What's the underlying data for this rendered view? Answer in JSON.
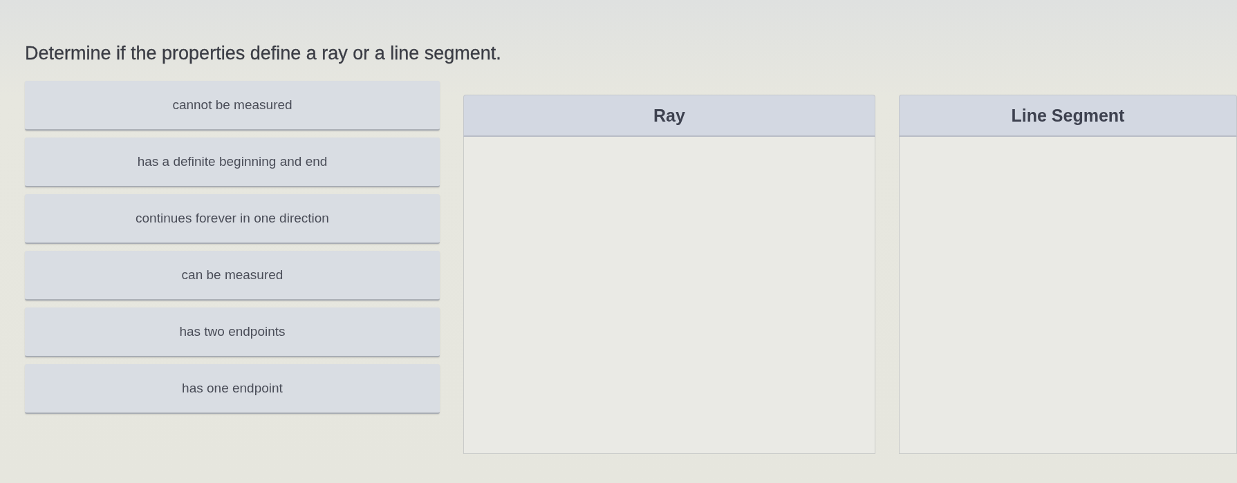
{
  "prompt": "Determine if the properties define a ray or a line segment.",
  "tiles": [
    {
      "label": "cannot be measured"
    },
    {
      "label": "has a definite beginning and end"
    },
    {
      "label": "continues forever in one direction"
    },
    {
      "label": "can be measured"
    },
    {
      "label": "has two endpoints"
    },
    {
      "label": "has one endpoint"
    }
  ],
  "bins": [
    {
      "heading": "Ray"
    },
    {
      "heading": "Line Segment"
    }
  ]
}
